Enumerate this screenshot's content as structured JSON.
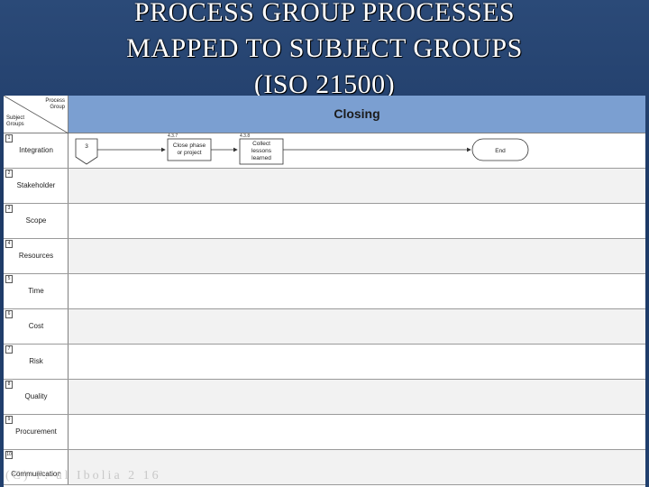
{
  "slide": {
    "title_lines": [
      "PROCESS GROUP PROCESSES",
      "MAPPED TO SUBJECT GROUPS",
      "(ISO 21500)"
    ],
    "footer": "(C) P. al Ibolia 2 16"
  },
  "matrix": {
    "corner": {
      "process_group": "Process Group",
      "subject_groups": "Subject Groups"
    },
    "column_header": "Closing",
    "rows": [
      {
        "num": "1",
        "label": "Integration"
      },
      {
        "num": "2",
        "label": "Stakeholder"
      },
      {
        "num": "3",
        "label": "Scope"
      },
      {
        "num": "4",
        "label": "Resources"
      },
      {
        "num": "5",
        "label": "Time"
      },
      {
        "num": "6",
        "label": "Cost"
      },
      {
        "num": "7",
        "label": "Risk"
      },
      {
        "num": "8",
        "label": "Quality"
      },
      {
        "num": "9",
        "label": "Procurement"
      },
      {
        "num": "10",
        "label": "Communication"
      }
    ]
  },
  "flow": {
    "connector": "3",
    "processes": [
      {
        "id": "4.3.7",
        "label_lines": [
          "Close phase",
          "or project"
        ]
      },
      {
        "id": "4.3.8",
        "label_lines": [
          "Collect",
          "lessons",
          "learned"
        ]
      }
    ],
    "end_label": "End"
  }
}
